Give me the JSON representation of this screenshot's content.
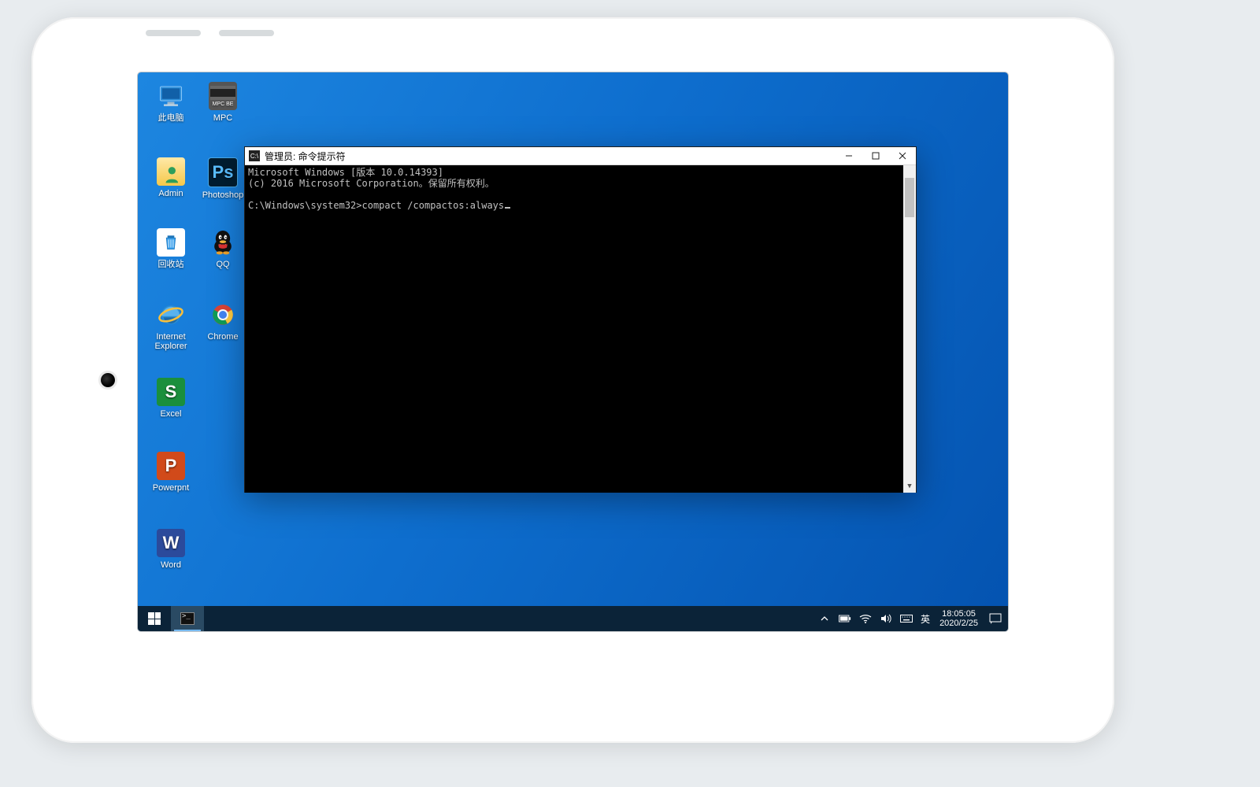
{
  "desktop_icons": {
    "thispc": "此电脑",
    "mpc": "MPC",
    "admin": "Admin",
    "photoshop": "Photoshop",
    "recycle": "回收站",
    "qq": "QQ",
    "ie": "Internet Explorer",
    "chrome": "Chrome",
    "excel": "Excel",
    "powerpnt": "Powerpnt",
    "word": "Word"
  },
  "cmd_window": {
    "title": "管理员: 命令提示符",
    "line1": "Microsoft Windows [版本 10.0.14393]",
    "line2": "(c) 2016 Microsoft Corporation。保留所有权利。",
    "prompt": "C:\\Windows\\system32>",
    "command": "compact /compactos:always"
  },
  "taskbar": {
    "ime": "英",
    "time": "18:05:05",
    "date": "2020/2/25"
  },
  "icon_glyphs": {
    "ps": "Ps",
    "excel": "S",
    "ppt": "P",
    "word": "W",
    "mpc": "MPC BE"
  }
}
